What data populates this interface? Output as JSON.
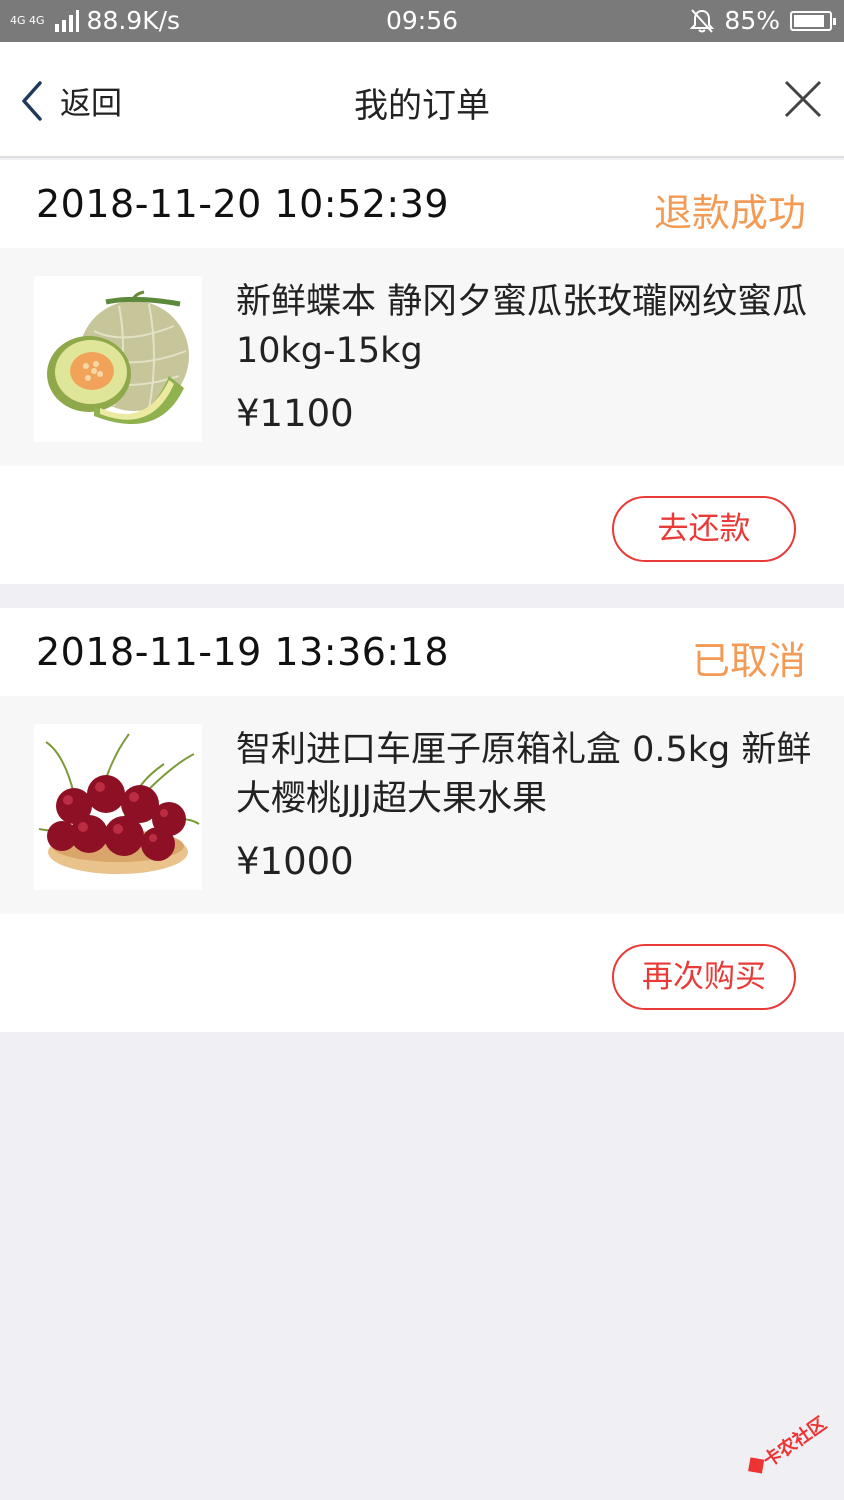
{
  "status_bar": {
    "network": "4G 4G",
    "speed": "88.9K/s",
    "time": "09:56",
    "battery": "85%"
  },
  "nav": {
    "back_label": "返回",
    "title": "我的订单"
  },
  "orders": [
    {
      "datetime": "2018-11-20 10:52:39",
      "status": "退款成功",
      "title": "新鲜蝶本 静冈夕蜜瓜张玫瓏网纹蜜瓜 10kg-15kg",
      "price": "¥1100",
      "action": "去还款",
      "image": "melon-image"
    },
    {
      "datetime": "2018-11-19 13:36:18",
      "status": "已取消",
      "title": "智利进口车厘子原箱礼盒 0.5kg 新鲜大樱桃JJJ超大果水果",
      "price": "¥1000",
      "action": "再次购买",
      "image": "cherry-image"
    }
  ],
  "watermark": "卡农社区",
  "colors": {
    "status_orange": "#f39a55",
    "action_red": "#e93a37",
    "page_bg": "#efeff4"
  }
}
